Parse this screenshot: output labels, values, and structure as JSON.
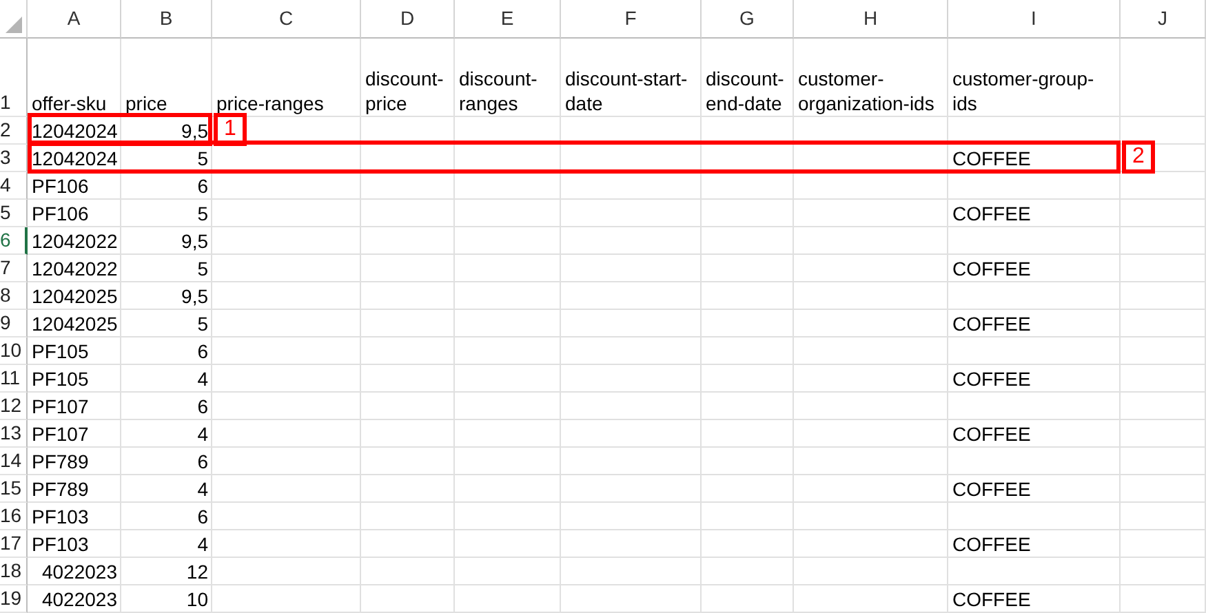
{
  "columns": [
    "A",
    "B",
    "C",
    "D",
    "E",
    "F",
    "G",
    "H",
    "I",
    "J"
  ],
  "rows": [
    {
      "number": "1",
      "active": false,
      "tall": true,
      "cells": {
        "A": {
          "text": "offer-sku",
          "kind": "text"
        },
        "B": {
          "text": "price",
          "kind": "text"
        },
        "C": {
          "text": "price-ranges",
          "kind": "text"
        },
        "D": {
          "text": "discount-price",
          "kind": "text"
        },
        "E": {
          "text": "discount-ranges",
          "kind": "text"
        },
        "F": {
          "text": "discount-start-date",
          "kind": "text"
        },
        "G": {
          "text": "discount-end-date",
          "kind": "text"
        },
        "H": {
          "text": "customer-organization-ids",
          "kind": "text"
        },
        "I": {
          "text": "customer-group-ids",
          "kind": "text"
        }
      }
    },
    {
      "number": "2",
      "active": false,
      "callout": {
        "label": "1"
      },
      "cells": {
        "A": {
          "text": "12042024",
          "kind": "text",
          "framed": true
        },
        "B": {
          "text": "9,5",
          "kind": "number",
          "framed": true
        }
      }
    },
    {
      "number": "3",
      "active": false,
      "callout": {
        "label": "2"
      },
      "cells": {
        "A": {
          "text": "12042024",
          "kind": "text",
          "framed": true
        },
        "B": {
          "text": "5",
          "kind": "number",
          "framed": true
        },
        "I": {
          "text": "COFFEE",
          "kind": "text",
          "framed": true
        }
      }
    },
    {
      "number": "4",
      "active": false,
      "cells": {
        "A": {
          "text": "PF106",
          "kind": "text"
        },
        "B": {
          "text": "6",
          "kind": "number"
        }
      }
    },
    {
      "number": "5",
      "active": false,
      "cells": {
        "A": {
          "text": "PF106",
          "kind": "text"
        },
        "B": {
          "text": "5",
          "kind": "number"
        },
        "I": {
          "text": "COFFEE",
          "kind": "text"
        }
      }
    },
    {
      "number": "6",
      "active": true,
      "cells": {
        "A": {
          "text": "12042022",
          "kind": "text"
        },
        "B": {
          "text": "9,5",
          "kind": "number"
        }
      }
    },
    {
      "number": "7",
      "active": false,
      "cells": {
        "A": {
          "text": "12042022",
          "kind": "text"
        },
        "B": {
          "text": "5",
          "kind": "number"
        },
        "I": {
          "text": "COFFEE",
          "kind": "text"
        }
      }
    },
    {
      "number": "8",
      "active": false,
      "cells": {
        "A": {
          "text": "12042025",
          "kind": "text"
        },
        "B": {
          "text": "9,5",
          "kind": "number"
        }
      }
    },
    {
      "number": "9",
      "active": false,
      "cells": {
        "A": {
          "text": "12042025",
          "kind": "text"
        },
        "B": {
          "text": "5",
          "kind": "number"
        },
        "I": {
          "text": "COFFEE",
          "kind": "text"
        }
      }
    },
    {
      "number": "10",
      "active": false,
      "cells": {
        "A": {
          "text": "PF105",
          "kind": "text"
        },
        "B": {
          "text": "6",
          "kind": "number"
        }
      }
    },
    {
      "number": "11",
      "active": false,
      "cells": {
        "A": {
          "text": "PF105",
          "kind": "text"
        },
        "B": {
          "text": "4",
          "kind": "number"
        },
        "I": {
          "text": "COFFEE",
          "kind": "text"
        }
      }
    },
    {
      "number": "12",
      "active": false,
      "cells": {
        "A": {
          "text": "PF107",
          "kind": "text"
        },
        "B": {
          "text": "6",
          "kind": "number"
        }
      }
    },
    {
      "number": "13",
      "active": false,
      "cells": {
        "A": {
          "text": "PF107",
          "kind": "text"
        },
        "B": {
          "text": "4",
          "kind": "number"
        },
        "I": {
          "text": "COFFEE",
          "kind": "text"
        }
      }
    },
    {
      "number": "14",
      "active": false,
      "cells": {
        "A": {
          "text": "PF789",
          "kind": "text"
        },
        "B": {
          "text": "6",
          "kind": "number"
        }
      }
    },
    {
      "number": "15",
      "active": false,
      "cells": {
        "A": {
          "text": "PF789",
          "kind": "text"
        },
        "B": {
          "text": "4",
          "kind": "number"
        },
        "I": {
          "text": "COFFEE",
          "kind": "text"
        }
      }
    },
    {
      "number": "16",
      "active": false,
      "cells": {
        "A": {
          "text": "PF103",
          "kind": "text"
        },
        "B": {
          "text": "6",
          "kind": "number"
        }
      }
    },
    {
      "number": "17",
      "active": false,
      "cells": {
        "A": {
          "text": "PF103",
          "kind": "text"
        },
        "B": {
          "text": "4",
          "kind": "number"
        },
        "I": {
          "text": "COFFEE",
          "kind": "text"
        }
      }
    },
    {
      "number": "18",
      "active": false,
      "cells": {
        "A": {
          "text": "4022023",
          "kind": "number"
        },
        "B": {
          "text": "12",
          "kind": "number"
        }
      }
    },
    {
      "number": "19",
      "active": false,
      "cells": {
        "A": {
          "text": "4022023",
          "kind": "number"
        },
        "B": {
          "text": "10",
          "kind": "number"
        },
        "I": {
          "text": "COFFEE",
          "kind": "text"
        }
      }
    }
  ]
}
